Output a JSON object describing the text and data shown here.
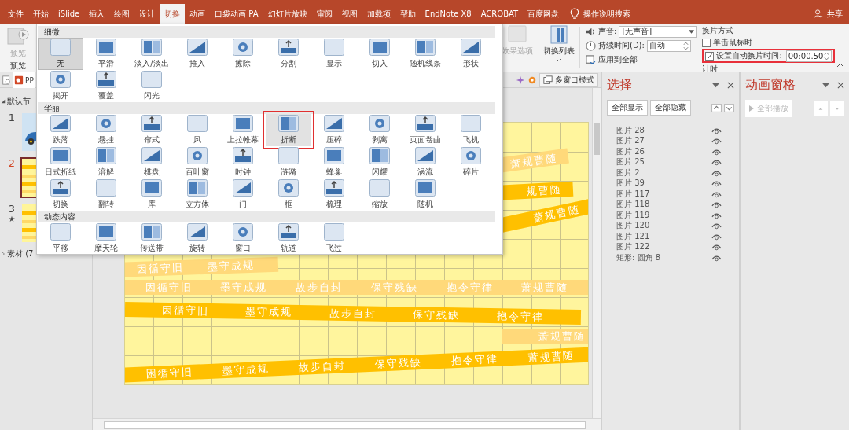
{
  "tabs": [
    {
      "label": "文件",
      "selected": false
    },
    {
      "label": "开始",
      "selected": false
    },
    {
      "label": "iSlide",
      "selected": false
    },
    {
      "label": "插入",
      "selected": false
    },
    {
      "label": "绘图",
      "selected": false
    },
    {
      "label": "设计",
      "selected": false
    },
    {
      "label": "切换",
      "selected": true
    },
    {
      "label": "动画",
      "selected": false
    },
    {
      "label": "口袋动画 PA",
      "selected": false
    },
    {
      "label": "幻灯片放映",
      "selected": false
    },
    {
      "label": "审阅",
      "selected": false
    },
    {
      "label": "视图",
      "selected": false
    },
    {
      "label": "加载项",
      "selected": false
    },
    {
      "label": "帮助",
      "selected": false
    },
    {
      "label": "EndNote X8",
      "selected": false
    },
    {
      "label": "ACROBAT",
      "selected": false
    },
    {
      "label": "百度网盘",
      "selected": false
    }
  ],
  "search": "操作说明搜索",
  "share": "共享",
  "preview": {
    "label": "预览",
    "group_label": "预览"
  },
  "effect_options": {
    "label": "效果选项",
    "disabled": true
  },
  "transition_list": "切换列表",
  "timing": {
    "sound": {
      "label": "声音:",
      "value": "[无声音]"
    },
    "duration": {
      "label": "持续时间(D):",
      "value": "自动"
    },
    "apply_all": "应用到全部",
    "advance_title": "换片方式",
    "on_click": {
      "label": "单击鼠标时",
      "checked": false
    },
    "after": {
      "label": "设置自动换片时间:",
      "checked": true,
      "value": "00:00.50",
      "highlighted": true
    },
    "group_label": "计时"
  },
  "gallery": {
    "sections": [
      {
        "title": "细微",
        "items": [
          {
            "label": "无",
            "selected": true,
            "highlighted": false
          },
          {
            "label": "平滑",
            "selected": false,
            "highlighted": false
          },
          {
            "label": "淡入/淡出",
            "selected": false,
            "highlighted": false
          },
          {
            "label": "推入",
            "selected": false,
            "highlighted": false
          },
          {
            "label": "擦除",
            "selected": false,
            "highlighted": false
          },
          {
            "label": "分割",
            "selected": false,
            "highlighted": false
          },
          {
            "label": "显示",
            "selected": false,
            "highlighted": false
          },
          {
            "label": "切入",
            "selected": false,
            "highlighted": false
          },
          {
            "label": "随机线条",
            "selected": false,
            "highlighted": false
          },
          {
            "label": "形状",
            "selected": false,
            "highlighted": false
          },
          {
            "label": "揭开",
            "selected": false,
            "highlighted": false
          },
          {
            "label": "覆盖",
            "selected": false,
            "highlighted": false
          },
          {
            "label": "闪光",
            "selected": false,
            "highlighted": false
          }
        ]
      },
      {
        "title": "华丽",
        "items": [
          {
            "label": "跌落",
            "selected": false,
            "highlighted": false
          },
          {
            "label": "悬挂",
            "selected": false,
            "highlighted": false
          },
          {
            "label": "帘式",
            "selected": false,
            "highlighted": false
          },
          {
            "label": "风",
            "selected": false,
            "highlighted": false
          },
          {
            "label": "上拉帷幕",
            "selected": false,
            "highlighted": false
          },
          {
            "label": "折断",
            "selected": false,
            "highlighted": true
          },
          {
            "label": "压碎",
            "selected": false,
            "highlighted": false
          },
          {
            "label": "剥离",
            "selected": false,
            "highlighted": false
          },
          {
            "label": "页面卷曲",
            "selected": false,
            "highlighted": false
          },
          {
            "label": "飞机",
            "selected": false,
            "highlighted": false
          },
          {
            "label": "日式折纸",
            "selected": false,
            "highlighted": false
          },
          {
            "label": "溶解",
            "selected": false,
            "highlighted": false
          },
          {
            "label": "棋盘",
            "selected": false,
            "highlighted": false
          },
          {
            "label": "百叶窗",
            "selected": false,
            "highlighted": false
          },
          {
            "label": "时钟",
            "selected": false,
            "highlighted": false
          },
          {
            "label": "涟漪",
            "selected": false,
            "highlighted": false
          },
          {
            "label": "蜂巢",
            "selected": false,
            "highlighted": false
          },
          {
            "label": "闪耀",
            "selected": false,
            "highlighted": false
          },
          {
            "label": "涡流",
            "selected": false,
            "highlighted": false
          },
          {
            "label": "碎片",
            "selected": false,
            "highlighted": false
          },
          {
            "label": "切换",
            "selected": false,
            "highlighted": false
          },
          {
            "label": "翻转",
            "selected": false,
            "highlighted": false
          },
          {
            "label": "库",
            "selected": false,
            "highlighted": false
          },
          {
            "label": "立方体",
            "selected": false,
            "highlighted": false
          },
          {
            "label": "门",
            "selected": false,
            "highlighted": false
          },
          {
            "label": "框",
            "selected": false,
            "highlighted": false
          },
          {
            "label": "梳理",
            "selected": false,
            "highlighted": false
          },
          {
            "label": "缩放",
            "selected": false,
            "highlighted": false
          },
          {
            "label": "随机",
            "selected": false,
            "highlighted": false
          }
        ]
      },
      {
        "title": "动态内容",
        "items": [
          {
            "label": "平移",
            "selected": false,
            "highlighted": false
          },
          {
            "label": "摩天轮",
            "selected": false,
            "highlighted": false
          },
          {
            "label": "传送带",
            "selected": false,
            "highlighted": false
          },
          {
            "label": "旋转",
            "selected": false,
            "highlighted": false
          },
          {
            "label": "窗口",
            "selected": false,
            "highlighted": false
          },
          {
            "label": "轨道",
            "selected": false,
            "highlighted": false
          },
          {
            "label": "飞过",
            "selected": false,
            "highlighted": false
          }
        ]
      }
    ]
  },
  "doc_tab": "PP",
  "multi_window": "多窗口模式",
  "outline": {
    "sections": [
      {
        "label": "默认节",
        "expanded": true,
        "slides": [
          {
            "number": "1",
            "selected": false,
            "kind": "car"
          },
          {
            "number": "2",
            "selected": true,
            "kind": "stripes"
          },
          {
            "number": "3",
            "selected": false,
            "kind": "stripes",
            "badge": "★"
          }
        ]
      },
      {
        "label": "素材 (7",
        "expanded": false
      }
    ]
  },
  "slide": {
    "banners": [
      {
        "words": [
          "萧规曹随"
        ],
        "faded": true
      },
      {
        "words": [
          "规曹随"
        ],
        "faded": false
      },
      {
        "words": [
          "萧规曹随"
        ],
        "faded": false
      },
      {
        "words": [
          "因循守旧",
          "墨守成规"
        ],
        "faded": true
      },
      {
        "words": [
          "因循守旧",
          "墨守成规",
          "故步自封",
          "保守残缺",
          "抱令守律",
          "萧规曹随"
        ],
        "faded": true
      },
      {
        "words": [
          "因循守旧",
          "墨守成规",
          "故步自封",
          "保守残缺",
          "抱令守律"
        ],
        "faded": false
      },
      {
        "words": [
          "萧规曹随"
        ],
        "faded": true
      },
      {
        "words": [
          "困循守旧",
          "墨守成规",
          "故步自封",
          "保守残缺",
          "抱令守律",
          "萧规曹随"
        ],
        "faded": false
      }
    ]
  },
  "selection_pane": {
    "title": "选择",
    "show_all": "全部显示",
    "hide_all": "全部隐藏",
    "items": [
      "图片 28",
      "图片 27",
      "图片 26",
      "图片 25",
      "图片 2",
      "图片 39",
      "图片 117",
      "图片 118",
      "图片 119",
      "图片 120",
      "图片 121",
      "图片 122",
      "矩形: 圆角 8"
    ]
  },
  "animation_pane": {
    "title": "动画窗格",
    "play_all": {
      "label": "全部播放",
      "disabled": true
    }
  }
}
